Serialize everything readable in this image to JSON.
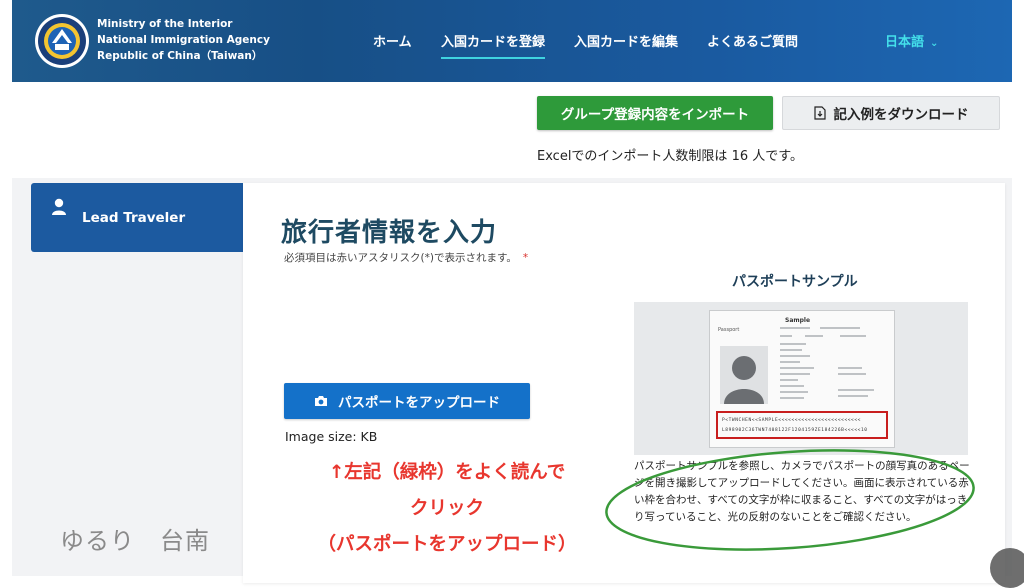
{
  "header": {
    "agency_lines": [
      "Ministry of the Interior",
      "National Immigration Agency",
      "Republic of China（Taiwan）"
    ],
    "nav": [
      {
        "label": "ホーム"
      },
      {
        "label": "入国カードを登録",
        "active": true
      },
      {
        "label": "入国カードを編集"
      },
      {
        "label": "よくあるご質問"
      }
    ],
    "language": "日本語"
  },
  "actions": {
    "import_label": "グループ登録内容をインポート",
    "download_label": "記入例をダウンロード",
    "limit_note": "Excelでのインポート人数制限は 16 人です。"
  },
  "sidebar": {
    "tab_label": "Lead Traveler"
  },
  "form": {
    "title": "旅行者情報を入力",
    "required_note": "必須項目は赤いアスタリスク(*)で表示されます。",
    "required_star": "*",
    "upload_label": "パスポートをアップロード",
    "image_size": "Image size: KB"
  },
  "sample": {
    "title": "パスポートサンプル",
    "passport_label": "Sample",
    "passport_word": "Passport",
    "mrz_line1": "P<TWNCHEN<<SAMPLE<<<<<<<<<<<<<<<<<<<<<<<<<",
    "mrz_line2": "L898902C36TWN7408122F1204159ZE184226B<<<<<10",
    "instructions": "パスポートサンプルを参照し、カメラでパスポートの顔写真のあるページを開き撮影してアップロードしてください。画面に表示されている赤い枠を合わせ、すべての文字が枠に収まること、すべての文字がはっきり写っていること、光の反射のないことをご確認ください。"
  },
  "annotation": {
    "line1": "↑左記（緑枠）をよく読んで",
    "line2": "クリック",
    "line3": "（パスポートをアップロード）"
  },
  "watermark": "ゆるり　台南",
  "colors": {
    "header": "#1a5aa0",
    "accent_cyan": "#44e0ea",
    "green_button": "#2e9a3a",
    "upload_button": "#1471c9",
    "annotation_red": "#e8362e",
    "ellipse_green": "#3a9a3a",
    "title_teal": "#1e4a62"
  }
}
